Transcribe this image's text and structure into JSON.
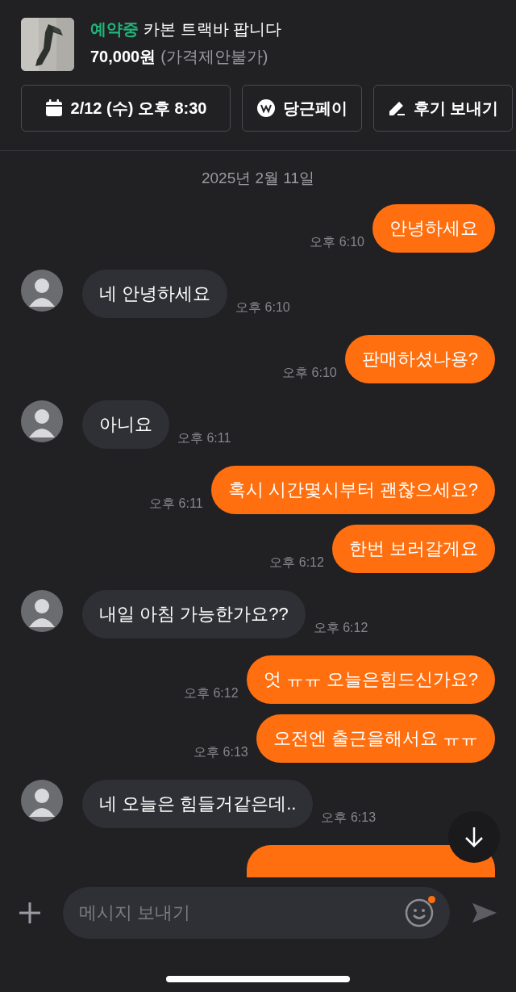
{
  "product": {
    "status": "예약중",
    "title": "카본 트랙바 팝니다",
    "price": "70,000원",
    "price_note": "(가격제안불가)"
  },
  "actions": [
    {
      "kind": "calendar",
      "label": "2/12 (수) 오후 8:30"
    },
    {
      "kind": "pay",
      "label": "당근페이"
    },
    {
      "kind": "review",
      "label": "후기 보내기"
    }
  ],
  "date": "2025년 2월 11일",
  "messages": [
    {
      "mine": true,
      "cut_off": false,
      "text": "안녕하세요",
      "time": "오후 6:10"
    },
    {
      "mine": false,
      "cut_off": false,
      "text": "네 안녕하세요",
      "time": "오후 6:10"
    },
    {
      "mine": true,
      "cut_off": false,
      "text": "판매하셨나용?",
      "time": "오후 6:10"
    },
    {
      "mine": false,
      "cut_off": false,
      "text": "아니요",
      "time": "오후 6:11"
    },
    {
      "mine": true,
      "cut_off": false,
      "text": "혹시 시간몇시부터 괜찮으세요?",
      "time": "오후 6:11"
    },
    {
      "mine": true,
      "cut_off": false,
      "text": "한번 보러갈게요",
      "time": "오후 6:12"
    },
    {
      "mine": false,
      "cut_off": false,
      "text": "내일 아침 가능한가요??",
      "time": "오후 6:12"
    },
    {
      "mine": true,
      "cut_off": false,
      "text": "엇 ㅠㅠ 오늘은힘드신가요?",
      "time": "오후 6:12"
    },
    {
      "mine": true,
      "cut_off": false,
      "text": "오전엔 출근을해서요 ㅠㅠ",
      "time": "오후 6:13"
    },
    {
      "mine": false,
      "cut_off": false,
      "text": "네 오늘은 힘들거같은데..",
      "time": "오후 6:13"
    },
    {
      "mine": true,
      "cut_off": true
    }
  ],
  "composer": {
    "placeholder": "메시지 보내기",
    "emoji_badge": true
  }
}
